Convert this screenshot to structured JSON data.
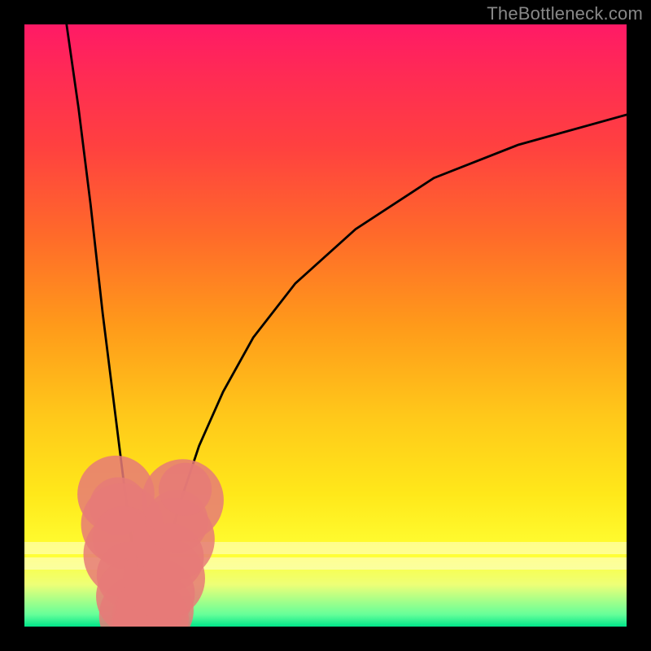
{
  "watermark": "TheBottleneck.com",
  "colors": {
    "frame": "#000000",
    "curve": "#000000",
    "dots": "#e67a78",
    "gradient_top": "#ff1a66",
    "gradient_bottom": "#00e58a"
  },
  "chart_data": {
    "type": "line",
    "title": "",
    "xlabel": "",
    "ylabel": "",
    "xlim": [
      0,
      100
    ],
    "ylim": [
      0,
      100
    ],
    "grid": false,
    "legend": false,
    "note": "Axes unlabeled in source image; values below are read off pixel positions relative to the 740x740 plot area (origin at bottom-left, x rightward, y upward, both 0-100).",
    "series": [
      {
        "name": "left-branch",
        "x": [
          7,
          9,
          11,
          13,
          14.5,
          16,
          17,
          18,
          18.8,
          19.3,
          19.7,
          20
        ],
        "y": [
          100,
          86,
          70,
          52,
          40,
          28,
          20,
          13,
          8,
          5,
          2.5,
          0.5
        ]
      },
      {
        "name": "right-branch",
        "x": [
          20,
          20.5,
          21.3,
          22.5,
          24,
          26,
          29,
          33,
          38,
          45,
          55,
          68,
          82,
          100
        ],
        "y": [
          0.5,
          2,
          5,
          9,
          14,
          21,
          30,
          39,
          48,
          57,
          66,
          74.5,
          80,
          85
        ]
      }
    ],
    "scatter": {
      "name": "dots-near-valley",
      "points": [
        {
          "x": 15.2,
          "y": 22.0,
          "r": 1.6
        },
        {
          "x": 15.6,
          "y": 20.0,
          "r": 1.2
        },
        {
          "x": 16.2,
          "y": 17.0,
          "r": 1.7
        },
        {
          "x": 16.5,
          "y": 14.8,
          "r": 1.3
        },
        {
          "x": 17.0,
          "y": 12.0,
          "r": 1.8
        },
        {
          "x": 17.6,
          "y": 8.5,
          "r": 1.4
        },
        {
          "x": 18.3,
          "y": 5.0,
          "r": 1.6
        },
        {
          "x": 19.2,
          "y": 1.8,
          "r": 1.7
        },
        {
          "x": 20.0,
          "y": 0.8,
          "r": 1.3
        },
        {
          "x": 20.9,
          "y": 1.3,
          "r": 1.6
        },
        {
          "x": 21.7,
          "y": 2.7,
          "r": 1.6
        },
        {
          "x": 22.7,
          "y": 5.5,
          "r": 1.4
        },
        {
          "x": 23.2,
          "y": 8.0,
          "r": 1.7
        },
        {
          "x": 24.2,
          "y": 11.5,
          "r": 1.4
        },
        {
          "x": 24.8,
          "y": 14.5,
          "r": 1.7
        },
        {
          "x": 25.3,
          "y": 17.5,
          "r": 1.3
        },
        {
          "x": 26.3,
          "y": 21.0,
          "r": 1.7
        },
        {
          "x": 26.7,
          "y": 22.8,
          "r": 1.1
        }
      ]
    },
    "bands": [
      {
        "y_from": 12,
        "y_to": 14,
        "kind": "pale"
      },
      {
        "y_from": 9.5,
        "y_to": 11.5,
        "kind": "pale"
      }
    ]
  }
}
